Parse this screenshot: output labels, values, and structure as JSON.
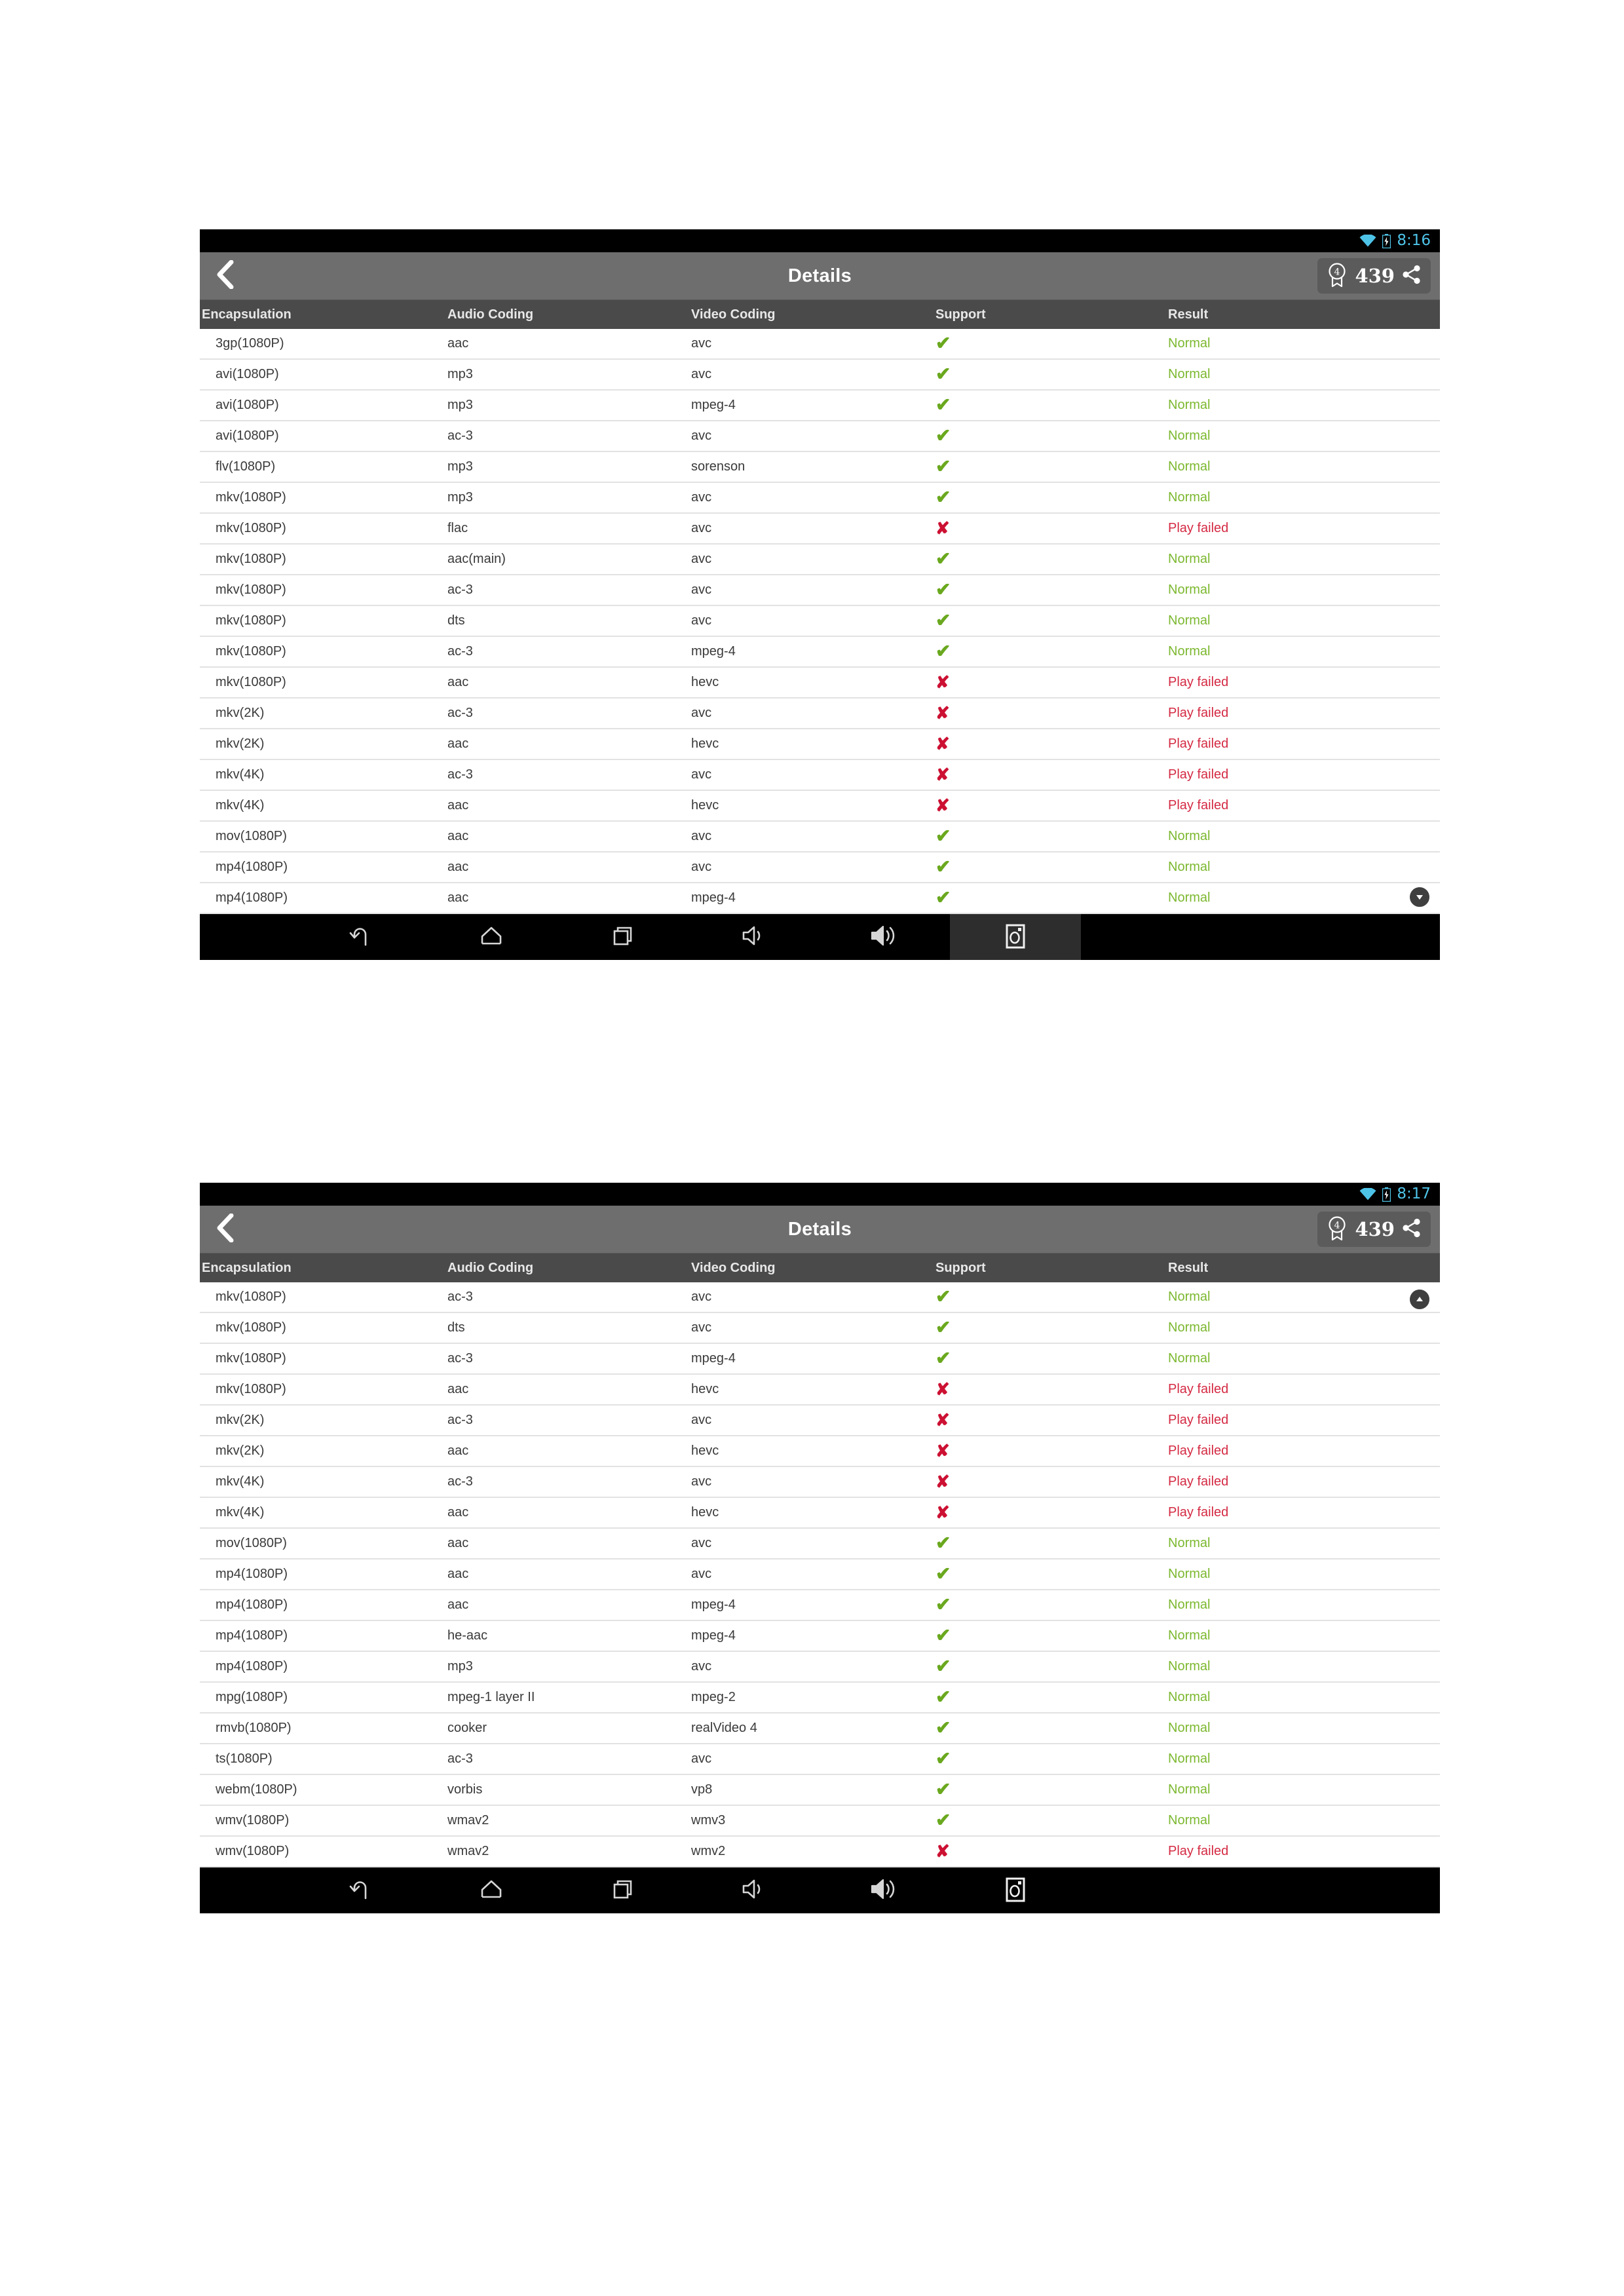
{
  "app": {
    "title": "Details",
    "accent_green": "#7cb82f",
    "accent_red": "#d42a43",
    "titlebar_bg": "#6e6e6e",
    "tablehead_bg": "#4a4a4a",
    "statusbar_time_color": "#4ec3e8"
  },
  "panels": [
    {
      "status": {
        "time": "8:16",
        "wifi_icon": "wifi-icon",
        "battery_icon": "battery-icon"
      },
      "titlebar": {
        "back_icon": "chevron-left-icon",
        "title": "Details",
        "badge_icon": "award-badge-icon",
        "badge_count": "439",
        "share_icon": "share-icon"
      },
      "columns": [
        "Encapsulation",
        "Audio Coding",
        "Video Coding",
        "Support",
        "Result"
      ],
      "scroll_indicator": "chevron-down-circle-icon",
      "scroll_position": "bottom",
      "rows": [
        {
          "encapsulation": "3gp(1080P)",
          "audio": "aac",
          "video": "avc",
          "support": "yes",
          "result": "Normal"
        },
        {
          "encapsulation": "avi(1080P)",
          "audio": "mp3",
          "video": "avc",
          "support": "yes",
          "result": "Normal"
        },
        {
          "encapsulation": "avi(1080P)",
          "audio": "mp3",
          "video": "mpeg-4",
          "support": "yes",
          "result": "Normal"
        },
        {
          "encapsulation": "avi(1080P)",
          "audio": "ac-3",
          "video": "avc",
          "support": "yes",
          "result": "Normal"
        },
        {
          "encapsulation": "flv(1080P)",
          "audio": "mp3",
          "video": "sorenson",
          "support": "yes",
          "result": "Normal"
        },
        {
          "encapsulation": "mkv(1080P)",
          "audio": "mp3",
          "video": "avc",
          "support": "yes",
          "result": "Normal"
        },
        {
          "encapsulation": "mkv(1080P)",
          "audio": "flac",
          "video": "avc",
          "support": "no",
          "result": "Play failed"
        },
        {
          "encapsulation": "mkv(1080P)",
          "audio": "aac(main)",
          "video": "avc",
          "support": "yes",
          "result": "Normal"
        },
        {
          "encapsulation": "mkv(1080P)",
          "audio": "ac-3",
          "video": "avc",
          "support": "yes",
          "result": "Normal"
        },
        {
          "encapsulation": "mkv(1080P)",
          "audio": "dts",
          "video": "avc",
          "support": "yes",
          "result": "Normal"
        },
        {
          "encapsulation": "mkv(1080P)",
          "audio": "ac-3",
          "video": "mpeg-4",
          "support": "yes",
          "result": "Normal"
        },
        {
          "encapsulation": "mkv(1080P)",
          "audio": "aac",
          "video": "hevc",
          "support": "no",
          "result": "Play failed"
        },
        {
          "encapsulation": "mkv(2K)",
          "audio": "ac-3",
          "video": "avc",
          "support": "no",
          "result": "Play failed"
        },
        {
          "encapsulation": "mkv(2K)",
          "audio": "aac",
          "video": "hevc",
          "support": "no",
          "result": "Play failed"
        },
        {
          "encapsulation": "mkv(4K)",
          "audio": "ac-3",
          "video": "avc",
          "support": "no",
          "result": "Play failed"
        },
        {
          "encapsulation": "mkv(4K)",
          "audio": "aac",
          "video": "hevc",
          "support": "no",
          "result": "Play failed"
        },
        {
          "encapsulation": "mov(1080P)",
          "audio": "aac",
          "video": "avc",
          "support": "yes",
          "result": "Normal"
        },
        {
          "encapsulation": "mp4(1080P)",
          "audio": "aac",
          "video": "avc",
          "support": "yes",
          "result": "Normal"
        },
        {
          "encapsulation": "mp4(1080P)",
          "audio": "aac",
          "video": "mpeg-4",
          "support": "yes",
          "result": "Normal"
        }
      ],
      "navbar": {
        "active_index": 5,
        "buttons": [
          {
            "icon": "back-arrow-icon",
            "label": "Back"
          },
          {
            "icon": "home-icon",
            "label": "Home"
          },
          {
            "icon": "recents-icon",
            "label": "Recents"
          },
          {
            "icon": "volume-down-icon",
            "label": "Volume down"
          },
          {
            "icon": "volume-up-icon",
            "label": "Volume up"
          },
          {
            "icon": "screenshot-icon",
            "label": "Screenshot"
          }
        ]
      }
    },
    {
      "status": {
        "time": "8:17",
        "wifi_icon": "wifi-icon",
        "battery_icon": "battery-icon"
      },
      "titlebar": {
        "back_icon": "chevron-left-icon",
        "title": "Details",
        "badge_icon": "award-badge-icon",
        "badge_count": "439",
        "share_icon": "share-icon"
      },
      "columns": [
        "Encapsulation",
        "Audio Coding",
        "Video Coding",
        "Support",
        "Result"
      ],
      "scroll_indicator": "chevron-up-circle-icon",
      "scroll_position": "top",
      "rows": [
        {
          "encapsulation": "mkv(1080P)",
          "audio": "ac-3",
          "video": "avc",
          "support": "yes",
          "result": "Normal"
        },
        {
          "encapsulation": "mkv(1080P)",
          "audio": "dts",
          "video": "avc",
          "support": "yes",
          "result": "Normal"
        },
        {
          "encapsulation": "mkv(1080P)",
          "audio": "ac-3",
          "video": "mpeg-4",
          "support": "yes",
          "result": "Normal"
        },
        {
          "encapsulation": "mkv(1080P)",
          "audio": "aac",
          "video": "hevc",
          "support": "no",
          "result": "Play failed"
        },
        {
          "encapsulation": "mkv(2K)",
          "audio": "ac-3",
          "video": "avc",
          "support": "no",
          "result": "Play failed"
        },
        {
          "encapsulation": "mkv(2K)",
          "audio": "aac",
          "video": "hevc",
          "support": "no",
          "result": "Play failed"
        },
        {
          "encapsulation": "mkv(4K)",
          "audio": "ac-3",
          "video": "avc",
          "support": "no",
          "result": "Play failed"
        },
        {
          "encapsulation": "mkv(4K)",
          "audio": "aac",
          "video": "hevc",
          "support": "no",
          "result": "Play failed"
        },
        {
          "encapsulation": "mov(1080P)",
          "audio": "aac",
          "video": "avc",
          "support": "yes",
          "result": "Normal"
        },
        {
          "encapsulation": "mp4(1080P)",
          "audio": "aac",
          "video": "avc",
          "support": "yes",
          "result": "Normal"
        },
        {
          "encapsulation": "mp4(1080P)",
          "audio": "aac",
          "video": "mpeg-4",
          "support": "yes",
          "result": "Normal"
        },
        {
          "encapsulation": "mp4(1080P)",
          "audio": "he-aac",
          "video": "mpeg-4",
          "support": "yes",
          "result": "Normal"
        },
        {
          "encapsulation": "mp4(1080P)",
          "audio": "mp3",
          "video": "avc",
          "support": "yes",
          "result": "Normal"
        },
        {
          "encapsulation": "mpg(1080P)",
          "audio": "mpeg-1 layer II",
          "video": "mpeg-2",
          "support": "yes",
          "result": "Normal"
        },
        {
          "encapsulation": "rmvb(1080P)",
          "audio": "cooker",
          "video": "realVideo 4",
          "support": "yes",
          "result": "Normal"
        },
        {
          "encapsulation": "ts(1080P)",
          "audio": "ac-3",
          "video": "avc",
          "support": "yes",
          "result": "Normal"
        },
        {
          "encapsulation": "webm(1080P)",
          "audio": "vorbis",
          "video": "vp8",
          "support": "yes",
          "result": "Normal"
        },
        {
          "encapsulation": "wmv(1080P)",
          "audio": "wmav2",
          "video": "wmv3",
          "support": "yes",
          "result": "Normal"
        },
        {
          "encapsulation": "wmv(1080P)",
          "audio": "wmav2",
          "video": "wmv2",
          "support": "no",
          "result": "Play failed"
        }
      ],
      "navbar": {
        "active_index": -1,
        "buttons": [
          {
            "icon": "back-arrow-icon",
            "label": "Back"
          },
          {
            "icon": "home-icon",
            "label": "Home"
          },
          {
            "icon": "recents-icon",
            "label": "Recents"
          },
          {
            "icon": "volume-down-icon",
            "label": "Volume down"
          },
          {
            "icon": "volume-up-icon",
            "label": "Volume up"
          },
          {
            "icon": "screenshot-icon",
            "label": "Screenshot"
          }
        ]
      }
    }
  ],
  "marks": {
    "yes": "✔",
    "no": "✘"
  }
}
